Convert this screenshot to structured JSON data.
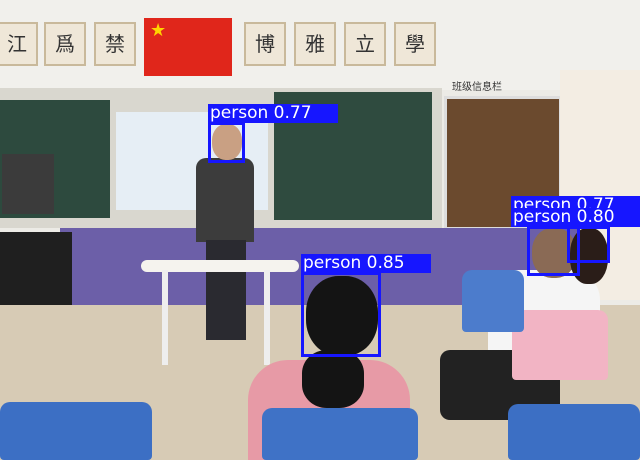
{
  "scene": {
    "wall_plaques": [
      "江",
      "爲",
      "禁",
      "博",
      "雅",
      "立",
      "學"
    ],
    "notice_board_title": "班级信息栏"
  },
  "detections": [
    {
      "label": "person",
      "score": "0.77",
      "text": "person 0.77"
    },
    {
      "label": "person",
      "score": "0.85",
      "text": "person 0.85"
    },
    {
      "label": "person",
      "score": "0.77",
      "text": "person 0.77"
    },
    {
      "label": "person",
      "score": "0.80",
      "text": "person 0.80"
    }
  ],
  "colors": {
    "box": "#1616ff",
    "label_text": "#ffffff"
  }
}
